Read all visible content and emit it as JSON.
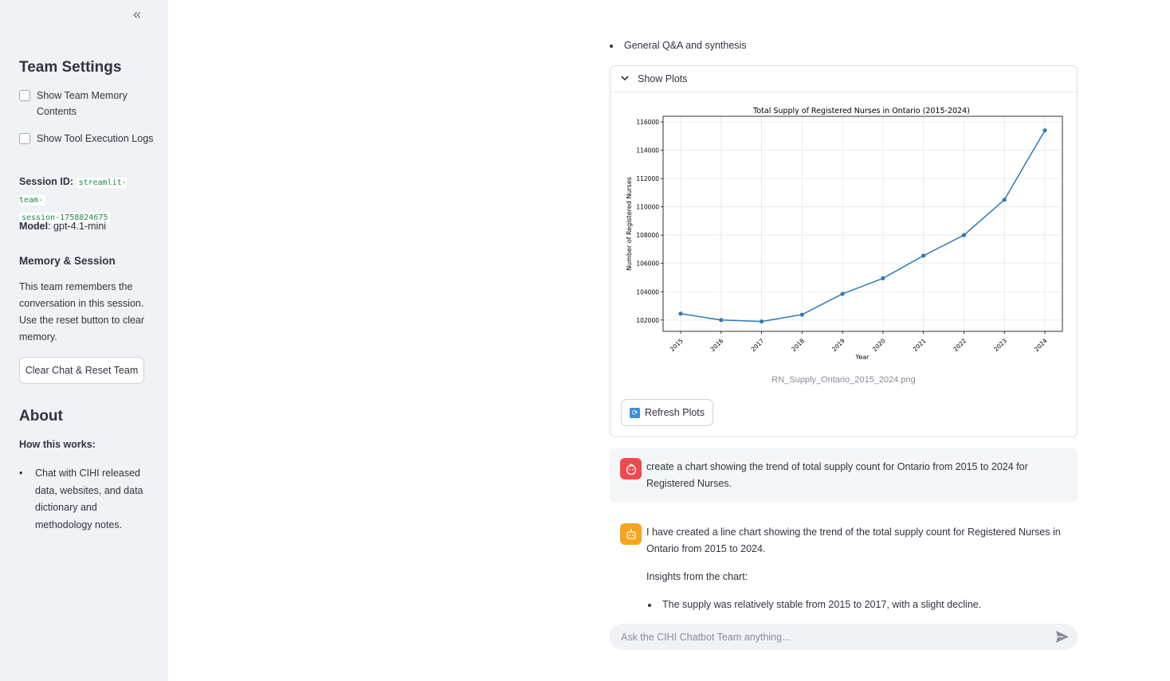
{
  "sidebar": {
    "collapse_icon": "«",
    "team_settings_title": "Team Settings",
    "checkbox_memory": "Show Team Memory Contents",
    "checkbox_tools": "Show Tool Execution Logs",
    "session_label": "Session ID:",
    "session_value_1": "streamlit-team-",
    "session_value_2": "session-1758824675",
    "model_label": "Model",
    "model_value": ": gpt-4.1-mini",
    "memory_title": "Memory & Session",
    "memory_text": "This team remembers the conversation in this session. Use the reset button to clear memory.",
    "reset_button": "Clear Chat & Reset Team",
    "about_title": "About",
    "how_title": "How this works:",
    "how_items": [
      "Chat with CIHI released data, websites, and data dictionary and methodology notes."
    ]
  },
  "main": {
    "top_bullet": "General Q&A and synthesis",
    "expander_label": "Show Plots",
    "plot_caption": "RN_Supply_Ontario_2015_2024.png",
    "refresh_button": "Refresh Plots",
    "user_message": "create a chart showing the trend of total supply count for Ontario from 2015 to 2024 for Registered Nurses.",
    "bot_message": "I have created a line chart showing the trend of the total supply count for Registered Nurses in Ontario from 2015 to 2024.",
    "bot_insights_label": "Insights from the chart:",
    "bot_insight_1": "The supply was relatively stable from 2015 to 2017, with a slight decline.",
    "input_placeholder": "Ask the CIHI Chatbot Team anything..."
  },
  "colors": {
    "line": "#2e7ab8",
    "user_avatar": "#f0494f",
    "bot_avatar": "#f7a51c"
  },
  "chart_data": {
    "type": "line",
    "title": "Total Supply of Registered Nurses in Ontario (2015-2024)",
    "xlabel": "Year",
    "ylabel": "Number of Registered Nurses",
    "x": [
      "2015",
      "2016",
      "2017",
      "2018",
      "2019",
      "2020",
      "2021",
      "2022",
      "2023",
      "2024"
    ],
    "values": [
      102450,
      102000,
      101900,
      102380,
      103850,
      104950,
      106550,
      108000,
      110500,
      115400
    ],
    "yticks": [
      102000,
      104000,
      106000,
      108000,
      110000,
      112000,
      114000,
      116000
    ],
    "ylim": [
      101200,
      116400
    ],
    "grid": true,
    "marker": "circle"
  }
}
